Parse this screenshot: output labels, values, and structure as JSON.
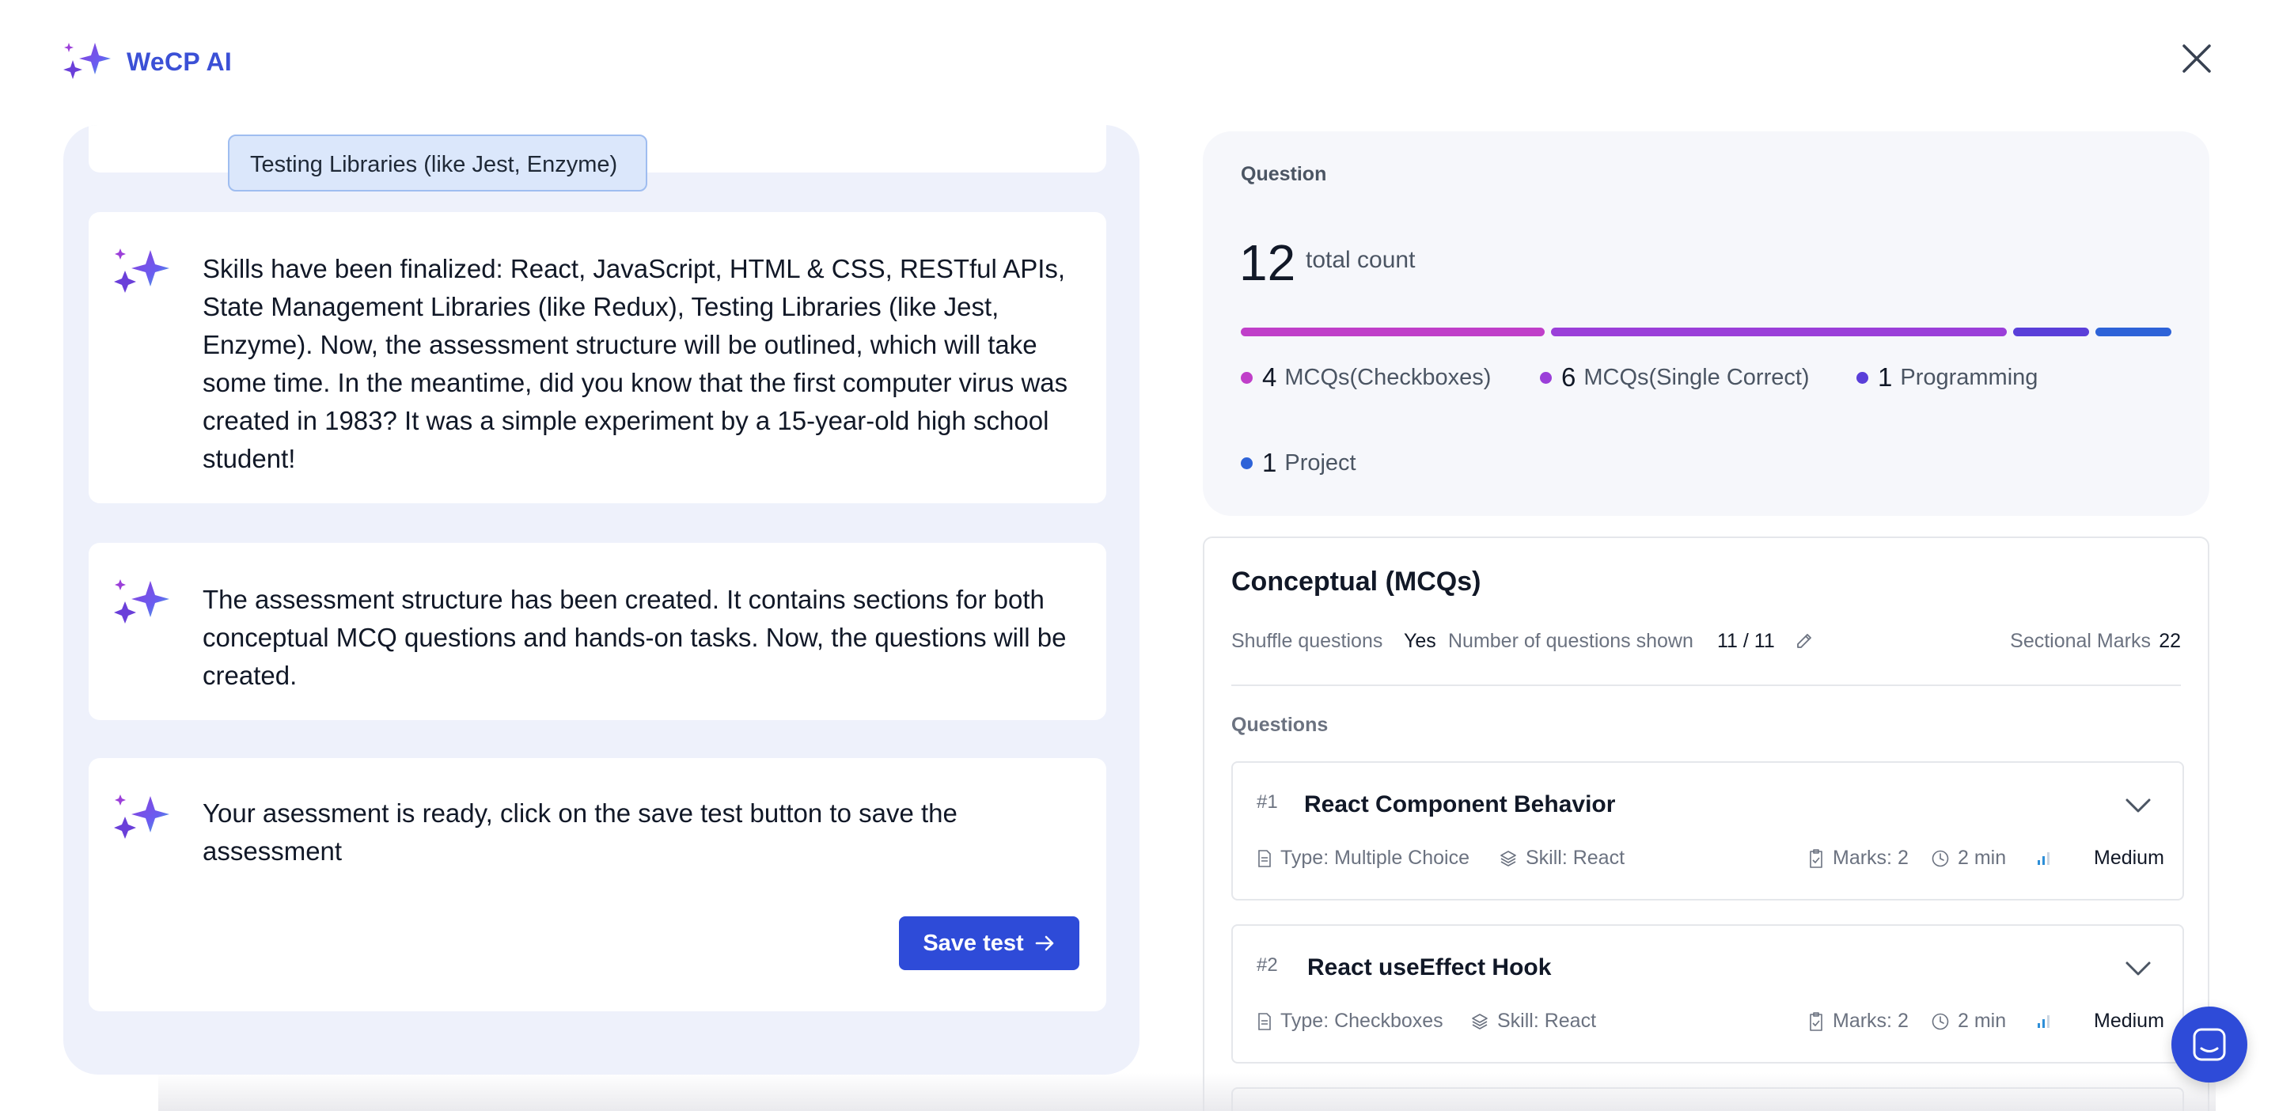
{
  "app": {
    "brand": "WeCP AI"
  },
  "chat": {
    "partial_chip": "Testing Libraries (like Jest, Enzyme)",
    "messages": [
      {
        "text": "Skills have been finalized: React, JavaScript, HTML & CSS, RESTful APIs, State Management Libraries (like Redux), Testing Libraries (like Jest, Enzyme). Now, the assessment structure will be outlined, which will take some time. In the meantime, did you know that the first computer virus was created in 1983? It was a simple experiment by a 15-year-old high school student!"
      },
      {
        "text": "The assessment structure has been created. It contains sections for both conceptual MCQ questions and hands-on tasks. Now, the questions will be created."
      },
      {
        "text": "Your asessment is ready, click on the save test button to save the assessment"
      }
    ],
    "save_button": "Save test"
  },
  "stats": {
    "label": "Question",
    "total": "12",
    "total_label": "total count",
    "breakdown": [
      {
        "count": "4",
        "label": "MCQs(Checkboxes)",
        "color": "#c03fc9",
        "value": 4
      },
      {
        "count": "6",
        "label": "MCQs(Single Correct)",
        "color": "#9b3fd9",
        "value": 6
      },
      {
        "count": "1",
        "label": "Programming",
        "color": "#5a3fd9",
        "value": 1
      },
      {
        "count": "1",
        "label": "Project",
        "color": "#2e63d8",
        "value": 1
      }
    ]
  },
  "section": {
    "title": "Conceptual (MCQs)",
    "shuffle_label": "Shuffle questions",
    "shuffle_value": "Yes",
    "shown_label": "Number of questions shown",
    "shown_value": "11 / 11",
    "marks_label": "Sectional Marks",
    "marks_value": "22",
    "questions_label": "Questions",
    "questions": [
      {
        "num": "#1",
        "title": "React Component Behavior",
        "type": "Type: Multiple Choice",
        "skill": "Skill: React",
        "marks": "Marks: 2",
        "time": "2 min",
        "difficulty": "Medium"
      },
      {
        "num": "#2",
        "title": "React useEffect Hook",
        "type": "Type: Checkboxes",
        "skill": "Skill: React",
        "marks": "Marks: 2",
        "time": "2 min",
        "difficulty": "Medium"
      }
    ]
  },
  "icons": {
    "logo": "sparkle-icon",
    "close": "close-icon",
    "launcher": "chat-icon"
  }
}
